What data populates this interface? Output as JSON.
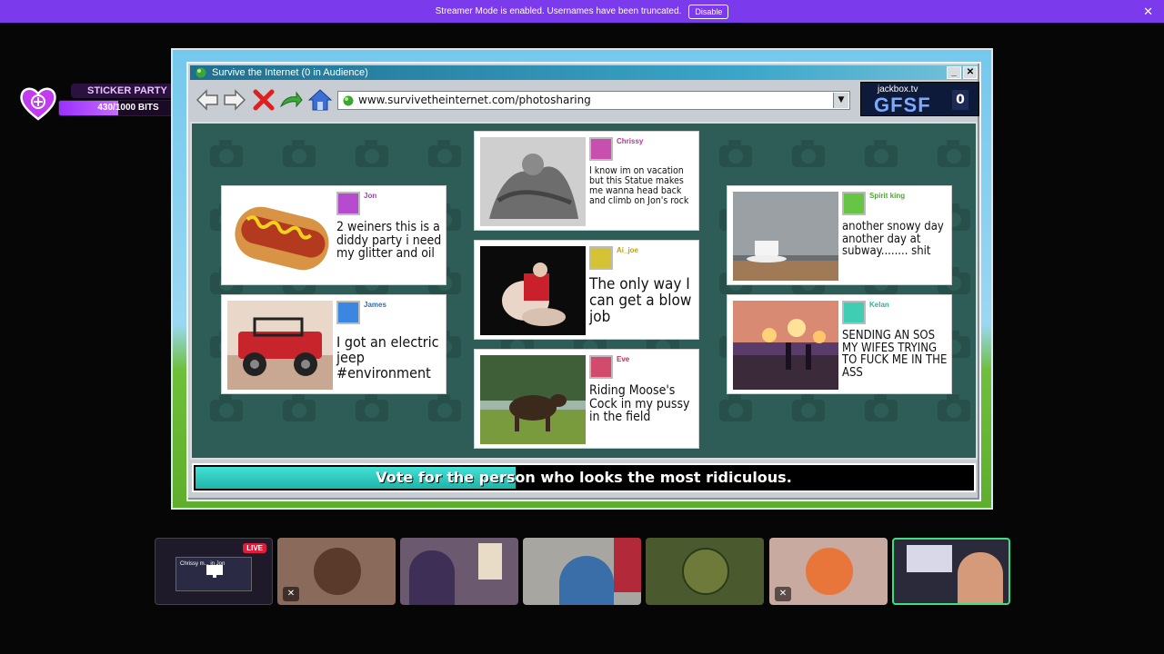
{
  "banner": {
    "message": "Streamer Mode is enabled. Usernames have been truncated.",
    "button": "Disable",
    "close": "✕"
  },
  "sticker": {
    "title": "STICKER PARTY",
    "bits": "430/1000 BITS",
    "progress": 0.43
  },
  "window": {
    "title": "Survive the Internet  (0 in Audience)",
    "url": "www.survivetheinternet.com/photosharing",
    "jackbox_url": "jackbox.tv",
    "room_code": "GFSF",
    "audience_count": "0",
    "minimize": "_",
    "close": "✕"
  },
  "cards": [
    {
      "user": "Jon",
      "user_color": "#a23cb8",
      "avatar_color": "#b64bd0",
      "caption": "2 weiners this is a diddy party i need my glitter and oil"
    },
    {
      "user": "James",
      "user_color": "#2f6dbd",
      "avatar_color": "#3b86e0",
      "caption": "I got an electric jeep #environment"
    },
    {
      "user": "Chrissy",
      "user_color": "#b4388f",
      "avatar_color": "#c84fb0",
      "caption": "I know im on vacation but this Statue makes me wanna head back and climb on Jon's rock"
    },
    {
      "user": "Ai_joe",
      "user_color": "#b8a21a",
      "avatar_color": "#d6c235",
      "caption": "The only way I can get a blow job"
    },
    {
      "user": "Eve",
      "user_color": "#c23256",
      "avatar_color": "#d24a6c",
      "caption": "Riding Moose's Cock in my pussy in the field"
    },
    {
      "user": "Spirit king",
      "user_color": "#4ea82f",
      "avatar_color": "#67c545",
      "caption": "another snowy day another day at subway........ shit"
    },
    {
      "user": "Kelan",
      "user_color": "#2cb39b",
      "avatar_color": "#3fcdb4",
      "caption": "SENDING AN SOS MY WIFES TRYING TO FUCK ME IN THE ASS"
    }
  ],
  "status": {
    "prompt": "Vote for the person who looks the most ridiculous.",
    "timer_progress": 0.41
  },
  "cams": {
    "live_label": "LIVE",
    "screen_share_text": "Chrissy m... in Jon",
    "mute_icon": "🎤"
  },
  "icons": {
    "back": "back-arrow-icon",
    "forward": "forward-arrow-icon",
    "stop": "stop-x-icon",
    "refresh": "refresh-arrow-icon",
    "home": "home-icon",
    "globe": "globe-icon",
    "heart": "heart-sticker-icon"
  }
}
